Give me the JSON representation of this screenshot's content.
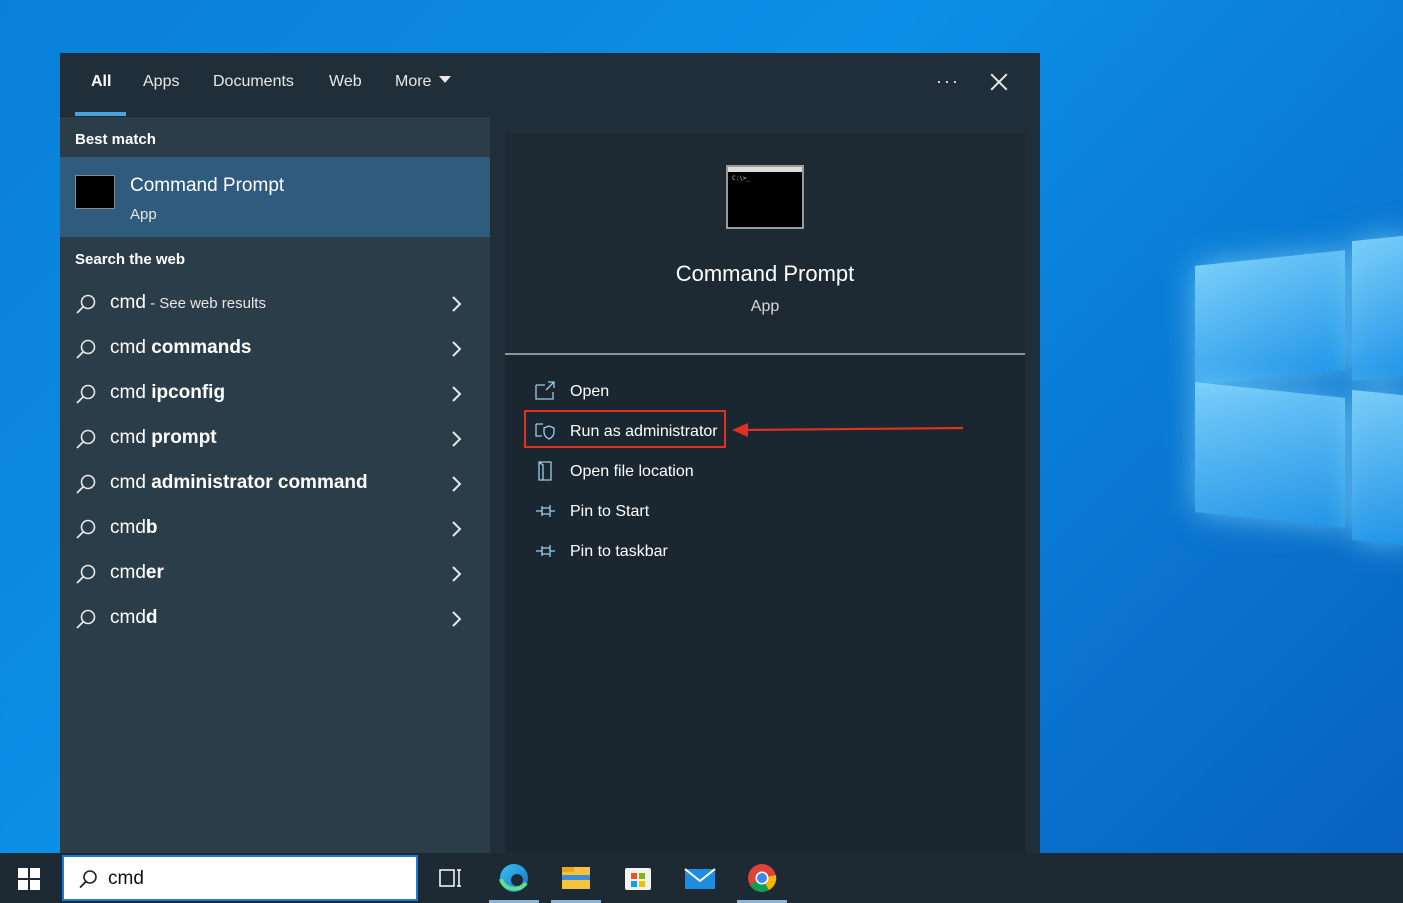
{
  "tabs": {
    "all": "All",
    "apps": "Apps",
    "documents": "Documents",
    "web": "Web",
    "more": "More",
    "options": "···"
  },
  "left": {
    "best_match_title": "Best match",
    "best_match": {
      "name": "Command Prompt",
      "type": "App"
    },
    "web_title": "Search the web",
    "web_results": [
      {
        "prefix": "cmd",
        "suffix": "",
        "hint": " - See web results"
      },
      {
        "prefix": "cmd ",
        "suffix": "commands",
        "hint": ""
      },
      {
        "prefix": "cmd ",
        "suffix": "ipconfig",
        "hint": ""
      },
      {
        "prefix": "cmd ",
        "suffix": "prompt",
        "hint": ""
      },
      {
        "prefix": "cmd ",
        "suffix": "administrator command",
        "hint": ""
      },
      {
        "prefix": "cmd",
        "suffix": "b",
        "hint": ""
      },
      {
        "prefix": "cmd",
        "suffix": "er",
        "hint": ""
      },
      {
        "prefix": "cmd",
        "suffix": "d",
        "hint": ""
      }
    ]
  },
  "right": {
    "name": "Command Prompt",
    "type": "App",
    "thumb_text": "C:\\>_",
    "actions": [
      {
        "label": "Open",
        "icon": "open-icon"
      },
      {
        "label": "Run as administrator",
        "icon": "shield-icon"
      },
      {
        "label": "Open file location",
        "icon": "folder-icon"
      },
      {
        "label": "Pin to Start",
        "icon": "pin-icon"
      },
      {
        "label": "Pin to taskbar",
        "icon": "pin-icon"
      }
    ]
  },
  "taskbar": {
    "search_value": "cmd",
    "icons": [
      "task-view-icon",
      "edge-icon",
      "file-explorer-icon",
      "store-icon",
      "mail-icon",
      "chrome-icon"
    ]
  },
  "colors": {
    "accent": "#4aa3df",
    "highlight_box": "#e0311f",
    "selected_row": "#2f5b7c"
  }
}
